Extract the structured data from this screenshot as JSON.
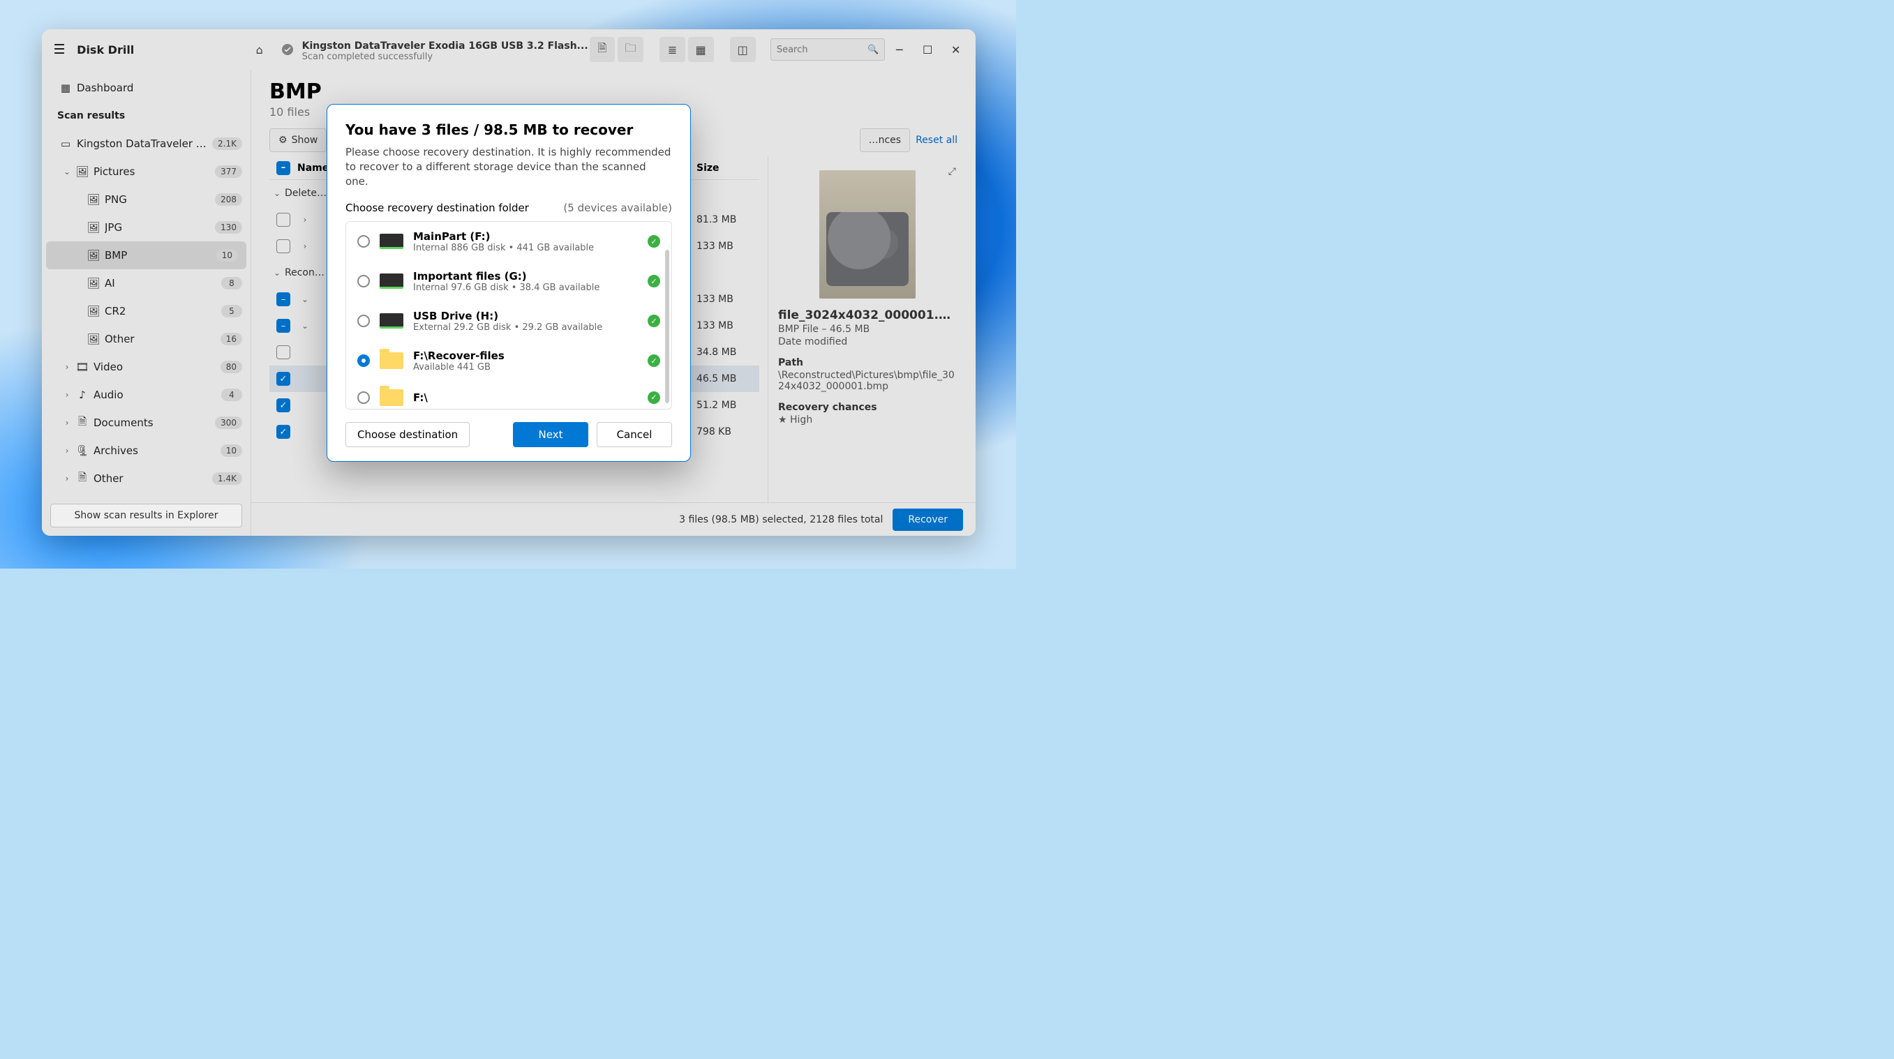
{
  "app": {
    "title": "Disk Drill"
  },
  "header": {
    "drive_title": "Kingston DataTraveler Exodia 16GB USB 3.2 Flash...",
    "drive_status": "Scan completed successfully",
    "search_placeholder": "Search"
  },
  "sidebar": {
    "dashboard": "Dashboard",
    "section": "Scan results",
    "device": {
      "label": "Kingston DataTraveler E...",
      "count": "2.1K"
    },
    "pictures": {
      "label": "Pictures",
      "count": "377"
    },
    "png": {
      "label": "PNG",
      "count": "208"
    },
    "jpg": {
      "label": "JPG",
      "count": "130"
    },
    "bmp": {
      "label": "BMP",
      "count": "10"
    },
    "ai": {
      "label": "AI",
      "count": "8"
    },
    "cr2": {
      "label": "CR2",
      "count": "5"
    },
    "othp": {
      "label": "Other",
      "count": "16"
    },
    "video": {
      "label": "Video",
      "count": "80"
    },
    "audio": {
      "label": "Audio",
      "count": "4"
    },
    "docs": {
      "label": "Documents",
      "count": "300"
    },
    "arch": {
      "label": "Archives",
      "count": "10"
    },
    "other": {
      "label": "Other",
      "count": "1.4K"
    },
    "footer_btn": "Show scan results in Explorer"
  },
  "main": {
    "heading": "BMP",
    "sub": "10 files",
    "show": "Show",
    "chances": "…nces",
    "reset": "Reset all",
    "col_name": "Name",
    "col_size": "Size",
    "groups": {
      "deleted": "Delete…",
      "recon": "Recon…"
    },
    "rows": [
      {
        "size": "81.3 MB"
      },
      {
        "size": "133 MB"
      },
      {
        "size": "133 MB"
      },
      {
        "size": "133 MB"
      },
      {
        "size": "34.8 MB"
      },
      {
        "size": "46.5 MB"
      },
      {
        "size": "51.2 MB"
      },
      {
        "size": "798 KB"
      }
    ]
  },
  "details": {
    "filename": "file_3024x4032_000001.b...",
    "type_size": "BMP File – 46.5 MB",
    "date_label": "Date modified",
    "path_label": "Path",
    "path_value": "\\Reconstructed\\Pictures\\bmp\\file_3024x4032_000001.bmp",
    "chances_label": "Recovery chances",
    "chances_value": "High"
  },
  "statusbar": {
    "summary": "3 files (98.5 MB) selected, 2128 files total",
    "recover": "Recover"
  },
  "modal": {
    "title": "You have 3 files / 98.5 MB to recover",
    "desc": "Please choose recovery destination. It is highly recommended to recover to a different storage device than the scanned one.",
    "choose_label": "Choose recovery destination folder",
    "devices_hint": "(5 devices available)",
    "dests": [
      {
        "name": "MainPart (F:)",
        "sub": "Internal 886 GB disk • 441 GB available",
        "icon": "drive",
        "selected": false
      },
      {
        "name": "Important files (G:)",
        "sub": "Internal 97.6 GB disk • 38.4 GB available",
        "icon": "drive",
        "selected": false
      },
      {
        "name": "USB Drive (H:)",
        "sub": "External 29.2 GB disk • 29.2 GB available",
        "icon": "drive",
        "selected": false
      },
      {
        "name": "F:\\Recover-files",
        "sub": "Available 441 GB",
        "icon": "folder",
        "selected": true
      },
      {
        "name": "F:\\",
        "sub": "",
        "icon": "folder",
        "selected": false
      }
    ],
    "choose_btn": "Choose destination",
    "next": "Next",
    "cancel": "Cancel"
  }
}
